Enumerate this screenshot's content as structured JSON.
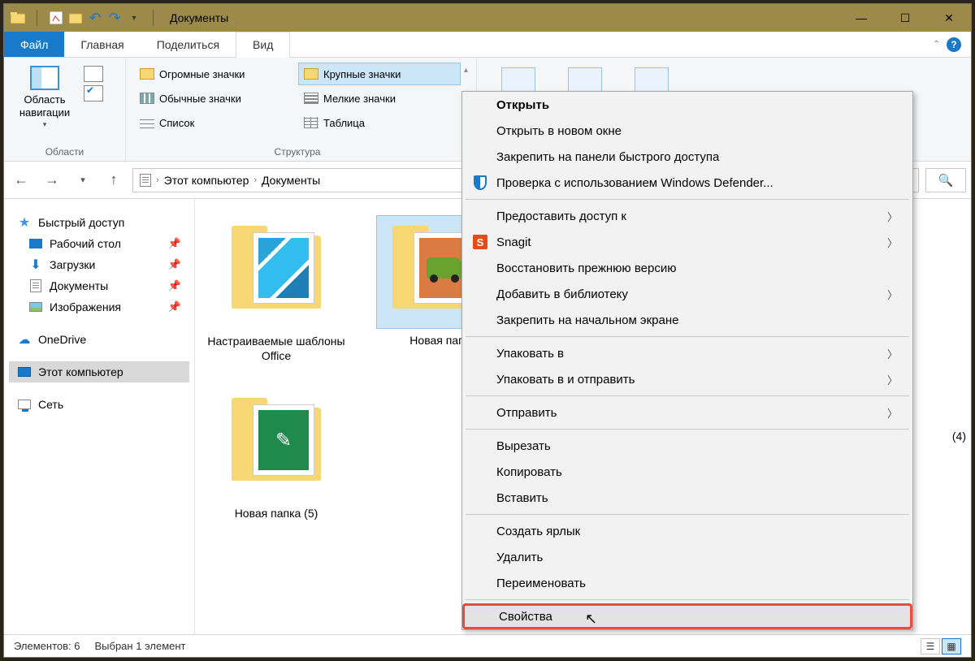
{
  "window": {
    "title": "Документы",
    "controls": {
      "min": "—",
      "max": "☐",
      "close": "✕"
    }
  },
  "tabs": {
    "file": "Файл",
    "home": "Главная",
    "share": "Поделиться",
    "view": "Вид",
    "collapse": "ˆ"
  },
  "ribbon": {
    "panes": {
      "nav": "Область навигации",
      "group_label": "Области"
    },
    "layout": {
      "huge": "Огромные значки",
      "large": "Крупные значки",
      "medium": "Обычные значки",
      "small": "Мелкие значки",
      "list": "Список",
      "table": "Таблица",
      "group_label": "Структура"
    }
  },
  "breadcrumb": {
    "root": "Этот компьютер",
    "folder": "Документы"
  },
  "sidebar": {
    "quick": "Быстрый доступ",
    "desktop": "Рабочий стол",
    "downloads": "Загрузки",
    "documents": "Документы",
    "pictures": "Изображения",
    "onedrive": "OneDrive",
    "thispc": "Этот компьютер",
    "network": "Сеть"
  },
  "content": {
    "folder1": "Настраиваемые шаблоны Office",
    "folder2_partial": "Новая пап",
    "folder3": "Новая папка (5)",
    "right_fragment": "(4)"
  },
  "statusbar": {
    "count": "Элементов: 6",
    "selected": "Выбран 1 элемент"
  },
  "ctx": {
    "open": "Открыть",
    "open_new": "Открыть в новом окне",
    "pin_quick": "Закрепить на панели быстрого доступа",
    "defender": "Проверка с использованием Windows Defender...",
    "share_access": "Предоставить доступ к",
    "snagit": "Snagit",
    "restore": "Восстановить прежнюю версию",
    "library": "Добавить в библиотеку",
    "pin_start": "Закрепить на начальном экране",
    "pack": "Упаковать в",
    "pack_send": "Упаковать в и отправить",
    "send": "Отправить",
    "cut": "Вырезать",
    "copy": "Копировать",
    "paste": "Вставить",
    "shortcut": "Создать ярлык",
    "delete": "Удалить",
    "rename": "Переименовать",
    "properties": "Свойства"
  }
}
